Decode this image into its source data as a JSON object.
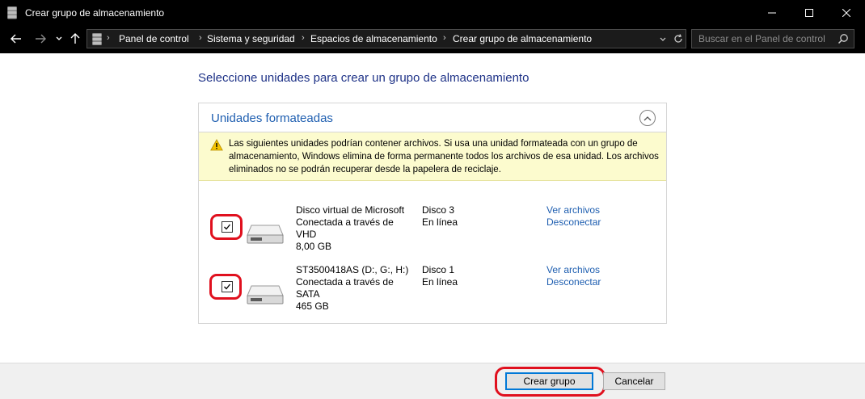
{
  "window": {
    "title": "Crear grupo de almacenamiento",
    "controls": {
      "minimize": "minimize-icon",
      "maximize": "maximize-icon",
      "close": "close-icon"
    }
  },
  "address_bar": {
    "breadcrumbs": [
      "Panel de control",
      "Sistema y seguridad",
      "Espacios de almacenamiento",
      "Crear grupo de almacenamiento"
    ],
    "search_placeholder": "Buscar en el Panel de control"
  },
  "main": {
    "heading": "Seleccione unidades para crear un grupo de almacenamiento",
    "section": {
      "title": "Unidades formateadas",
      "warning": "Las siguientes unidades podrían contener archivos. Si usa una unidad formateada con un grupo de almacenamiento, Windows elimina de forma permanente todos los archivos de esa unidad. Los archivos eliminados no se podrán recuperar desde la papelera de reciclaje.",
      "drives": [
        {
          "name": "Disco virtual de Microsoft",
          "connection": "Conectada a través de VHD",
          "size": "8,00 GB",
          "disk": "Disco 3",
          "status": "En línea",
          "view_files": "Ver archivos",
          "disconnect": "Desconectar",
          "checked": true
        },
        {
          "name": "ST3500418AS (D:, G:, H:)",
          "connection": "Conectada a través de SATA",
          "size": "465 GB",
          "disk": "Disco 1",
          "status": "En línea",
          "view_files": "Ver archivos",
          "disconnect": "Desconectar",
          "checked": true
        }
      ]
    }
  },
  "footer": {
    "create_label": "Crear grupo",
    "cancel_label": "Cancelar"
  },
  "colors": {
    "heading": "#1e3287",
    "link": "#1e5eb0",
    "warning_bg": "#fcfbce",
    "highlight": "#e0101e"
  }
}
